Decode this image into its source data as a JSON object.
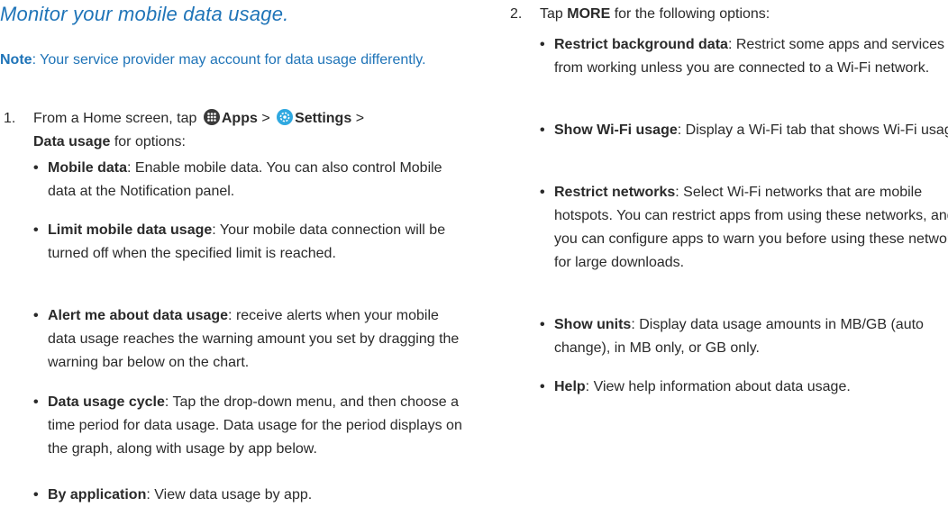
{
  "heading": "Monitor your mobile data usage.",
  "note": {
    "label": "Note",
    "text": ": Your service provider may account for data usage differently."
  },
  "step1": {
    "number": "1.",
    "prefix": "From a Home screen, tap",
    "apps": "Apps",
    "sep1": ">",
    "settings": "Settings",
    "sep2": ">",
    "data_usage": "Data usage",
    "suffix": "for options:",
    "icons": [
      "apps-grid-icon",
      "settings-gear-icon"
    ],
    "items": [
      {
        "title": "Mobile data",
        "text": ": Enable mobile data. You can also control Mobile data at the Notification panel."
      },
      {
        "title": "Limit mobile data usage",
        "text": ": Your mobile data connection will be turned off when the specified limit is reached."
      },
      {
        "title": "Alert me about data usage",
        "text": ": receive alerts when your mobile data usage reaches the warning amount you set by dragging the warning bar below on the chart."
      },
      {
        "title": "Data usage cycle",
        "text": ": Tap the drop-down menu, and then choose a time period for data usage. Data usage for the period displays on the graph, along with usage by app below."
      },
      {
        "title": "By application",
        "text": ": View data usage by app."
      }
    ]
  },
  "step2": {
    "number": "2.",
    "prefix": "Tap",
    "more": "MORE",
    "suffix": "for the following options:",
    "items": [
      {
        "title": "Restrict background data",
        "text": ": Restrict some apps and services from working unless you are connected to a Wi-Fi network."
      },
      {
        "title": "Show Wi-Fi usage",
        "text": ": Display a Wi-Fi tab that shows Wi-Fi usage."
      },
      {
        "title": "Restrict networks",
        "text": ": Select Wi-Fi networks that are mobile hotspots. You can restrict apps from using these networks, and you can configure apps to warn you before using these networks for large downloads."
      },
      {
        "title": "Show units",
        "text": ": Display data usage amounts in MB/GB (auto change), in MB only, or GB only."
      },
      {
        "title": "Help",
        "text": ": View help information about data usage."
      }
    ]
  },
  "bullet": "•",
  "colors": {
    "accent": "#1f74b8",
    "text": "#2a2a2a",
    "apps_icon": "#3a3a3a",
    "settings_icon": "#2fa8e0"
  }
}
